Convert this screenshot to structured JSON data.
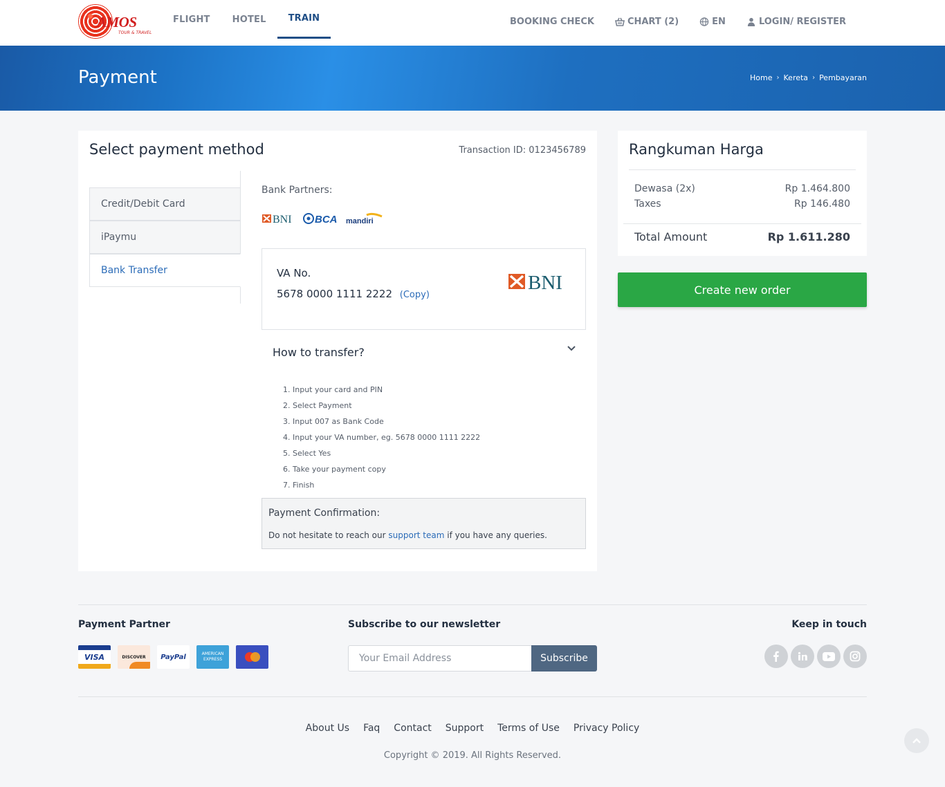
{
  "brand": {
    "name": "AMOS",
    "tagline": "TOUR & TRAVEL"
  },
  "nav": {
    "left": [
      {
        "label": "FLIGHT",
        "active": false
      },
      {
        "label": "HOTEL",
        "active": false
      },
      {
        "label": "TRAIN",
        "active": true
      }
    ],
    "booking_check": "BOOKING CHECK",
    "chart": "CHART (2)",
    "language": "EN",
    "login": "LOGIN/ REGISTER"
  },
  "banner": {
    "title": "Payment",
    "breadcrumb": [
      "Home",
      "Kereta",
      "Pembayaran"
    ]
  },
  "payment": {
    "title": "Select payment method",
    "transaction_label": "Transaction ID: ",
    "transaction_id": "0123456789",
    "tabs": [
      "Credit/Debit Card",
      "iPaymu",
      "Bank Transfer"
    ],
    "active_tab": "Bank Transfer",
    "bank_partners_label": "Bank Partners:",
    "bank_partners": [
      "BNI",
      "BCA",
      "mandiri"
    ],
    "va_label": "VA No.",
    "va_number": "5678 0000 1111 2222",
    "copy_label": "(Copy)",
    "va_bank": "BNI",
    "how_to_title": "How to transfer?",
    "steps": [
      "1. Input your card and PIN",
      "2. Select Payment",
      "3. Input 007 as Bank Code",
      "4. Input your VA number, eg. 5678 0000 1111 2222",
      "5. Select Yes",
      "6. Take your payment copy",
      "7. Finish"
    ],
    "confirmation_title": "Payment Confirmation:",
    "confirmation_before": "Do not hesitate to reach our ",
    "confirmation_link": "support team",
    "confirmation_after": " if you have any queries."
  },
  "summary": {
    "title": "Rangkuman Harga",
    "rows": [
      {
        "label": "Dewasa (2x)",
        "value": "Rp 1.464.800"
      },
      {
        "label": "Taxes",
        "value": "Rp 146.480"
      }
    ],
    "total_label": "Total Amount",
    "total_value": "Rp 1.611.280",
    "create_button": "Create new order"
  },
  "footer": {
    "payment_partner_title": "Payment Partner",
    "payment_cards": [
      "VISA",
      "DISCOVER",
      "PayPal",
      "AMERICAN EXPRESS",
      "mastercard"
    ],
    "newsletter_title": "Subscribe to our newsletter",
    "email_placeholder": "Your Email Address",
    "subscribe_label": "Subscribe",
    "keep_in_touch": "Keep in touch",
    "socials": [
      "facebook-icon",
      "linkedin-icon",
      "youtube-icon",
      "instagram-icon"
    ],
    "links": [
      "About Us",
      "Faq",
      "Contact",
      "Support",
      "Terms of Use",
      "Privacy Policy"
    ],
    "copyright": "Copyright © 2019. All Rights Reserved."
  },
  "colors": {
    "primary": "#1f4e86",
    "link": "#2c6cb8",
    "success": "#2aa745",
    "subscribe": "#4f6782"
  }
}
